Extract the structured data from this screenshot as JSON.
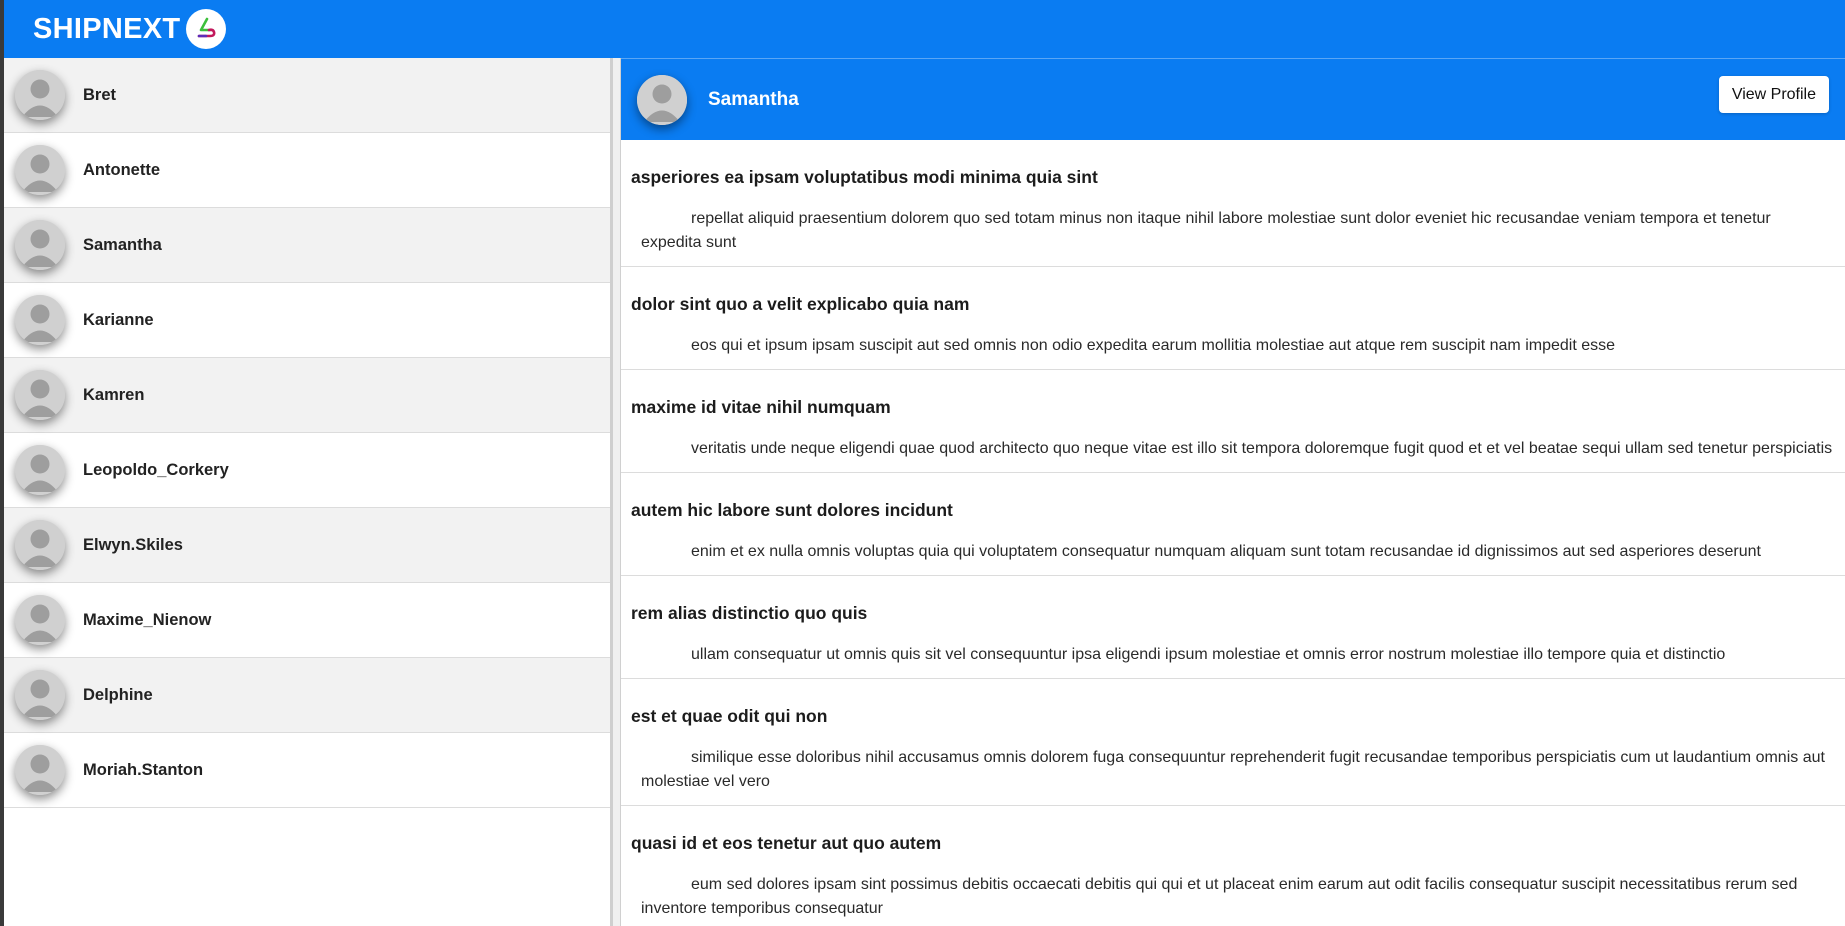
{
  "app": {
    "brand": "SHIPNEXT",
    "accent_color": "#0a7cf2",
    "logo_icon": "shipnext-logo-icon"
  },
  "contacts": [
    {
      "name": "Bret",
      "icon": "user-avatar-icon"
    },
    {
      "name": "Antonette",
      "icon": "user-avatar-icon"
    },
    {
      "name": "Samantha",
      "icon": "user-avatar-icon"
    },
    {
      "name": "Karianne",
      "icon": "user-avatar-icon"
    },
    {
      "name": "Kamren",
      "icon": "user-avatar-icon"
    },
    {
      "name": "Leopoldo_Corkery",
      "icon": "user-avatar-icon"
    },
    {
      "name": "Elwyn.Skiles",
      "icon": "user-avatar-icon"
    },
    {
      "name": "Maxime_Nienow",
      "icon": "user-avatar-icon"
    },
    {
      "name": "Delphine",
      "icon": "user-avatar-icon"
    },
    {
      "name": "Moriah.Stanton",
      "icon": "user-avatar-icon"
    }
  ],
  "chat": {
    "name": "Samantha",
    "view_profile_label": "View Profile"
  },
  "posts": [
    {
      "title": "asperiores ea ipsam voluptatibus modi minima quia sint",
      "body": "repellat aliquid praesentium dolorem quo sed totam minus non itaque nihil labore molestiae sunt dolor eveniet hic recusandae veniam tempora et tenetur expedita sunt"
    },
    {
      "title": "dolor sint quo a velit explicabo quia nam",
      "body": "eos qui et ipsum ipsam suscipit aut sed omnis non odio expedita earum mollitia molestiae aut atque rem suscipit nam impedit esse"
    },
    {
      "title": "maxime id vitae nihil numquam",
      "body": "veritatis unde neque eligendi quae quod architecto quo neque vitae est illo sit tempora doloremque fugit quod et et vel beatae sequi ullam sed tenetur perspiciatis"
    },
    {
      "title": "autem hic labore sunt dolores incidunt",
      "body": "enim et ex nulla omnis voluptas quia qui voluptatem consequatur numquam aliquam sunt totam recusandae id dignissimos aut sed asperiores deserunt"
    },
    {
      "title": "rem alias distinctio quo quis",
      "body": "ullam consequatur ut omnis quis sit vel consequuntur ipsa eligendi ipsum molestiae et omnis error nostrum molestiae illo tempore quia et distinctio"
    },
    {
      "title": "est et quae odit qui non",
      "body": "similique esse doloribus nihil accusamus omnis dolorem fuga consequuntur reprehenderit fugit recusandae temporibus perspiciatis cum ut laudantium omnis aut molestiae vel vero"
    },
    {
      "title": "quasi id et eos tenetur aut quo autem",
      "body": "eum sed dolores ipsam sint possimus debitis occaecati debitis qui qui et ut placeat enim earum aut odit facilis consequatur suscipit necessitatibus rerum sed inventore temporibus consequatur"
    }
  ]
}
